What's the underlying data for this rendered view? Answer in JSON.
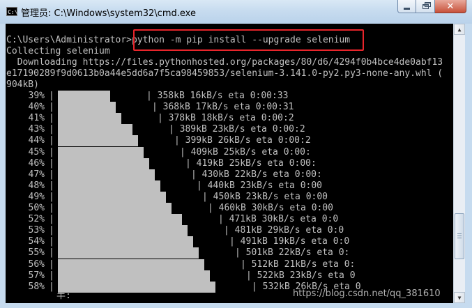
{
  "window": {
    "title": "管理员: C:\\Windows\\system32\\cmd.exe",
    "icon_text": "C:\\"
  },
  "console": {
    "prompt": "C:\\Users\\Administrator>",
    "command": "python -m pip install --upgrade selenium",
    "collecting": "Collecting selenium",
    "download_lines": [
      "  Downloading https://files.pythonhosted.org/packages/80/d6/4294f0b4bce4de0abf13",
      "e17190289f9d0613b0a44e5dd6a7f5ca98459853/selenium-3.141.0-py2.py3-none-any.whl (",
      "904kB)"
    ],
    "progress_rows": [
      {
        "pct": "39%",
        "progress": 0.39,
        "info": "| 358kB 16kB/s eta 0:00:33"
      },
      {
        "pct": "40%",
        "progress": 0.4,
        "info": "| 368kB 17kB/s eta 0:00:31"
      },
      {
        "pct": "41%",
        "progress": 0.41,
        "info": "| 378kB 18kB/s eta 0:00:2"
      },
      {
        "pct": "43%",
        "progress": 0.43,
        "info": "| 389kB 23kB/s eta 0:00:2"
      },
      {
        "pct": "44%",
        "progress": 0.44,
        "info": "| 399kB 26kB/s eta 0:00:2"
      },
      {
        "pct": "45%",
        "progress": 0.45,
        "info": "| 409kB 25kB/s eta 0:00:"
      },
      {
        "pct": "46%",
        "progress": 0.46,
        "info": "| 419kB 25kB/s eta 0:00:"
      },
      {
        "pct": "47%",
        "progress": 0.47,
        "info": "| 430kB 22kB/s eta 0:00:"
      },
      {
        "pct": "48%",
        "progress": 0.48,
        "info": "| 440kB 23kB/s eta 0:00"
      },
      {
        "pct": "49%",
        "progress": 0.49,
        "info": "| 450kB 23kB/s eta 0:00"
      },
      {
        "pct": "50%",
        "progress": 0.5,
        "info": "| 460kB 30kB/s eta 0:00"
      },
      {
        "pct": "52%",
        "progress": 0.52,
        "info": "| 471kB 30kB/s eta 0:0"
      },
      {
        "pct": "53%",
        "progress": 0.53,
        "info": "| 481kB 29kB/s eta 0:0"
      },
      {
        "pct": "54%",
        "progress": 0.54,
        "info": "| 491kB 19kB/s eta 0:0"
      },
      {
        "pct": "55%",
        "progress": 0.55,
        "info": "| 501kB 22kB/s eta 0:"
      },
      {
        "pct": "56%",
        "progress": 0.56,
        "info": "| 512kB 21kB/s eta 0:"
      },
      {
        "pct": "57%",
        "progress": 0.57,
        "info": "| 522kB 23kB/s eta 0"
      },
      {
        "pct": "58%",
        "progress": 0.58,
        "info": "| 532kB 26kB/s eta 0"
      }
    ],
    "cursor_line": "半:"
  },
  "watermark": "https://blog.csdn.net/qq_381610",
  "colors": {
    "console_bg": "#000000",
    "console_fg": "#c0c0c0",
    "highlight": "#e8252b",
    "close_button": "#c7513a"
  },
  "icons": [
    "cmd-icon",
    "minimize-icon",
    "maximize-icon",
    "close-icon",
    "scroll-up-icon",
    "scroll-down-icon"
  ]
}
